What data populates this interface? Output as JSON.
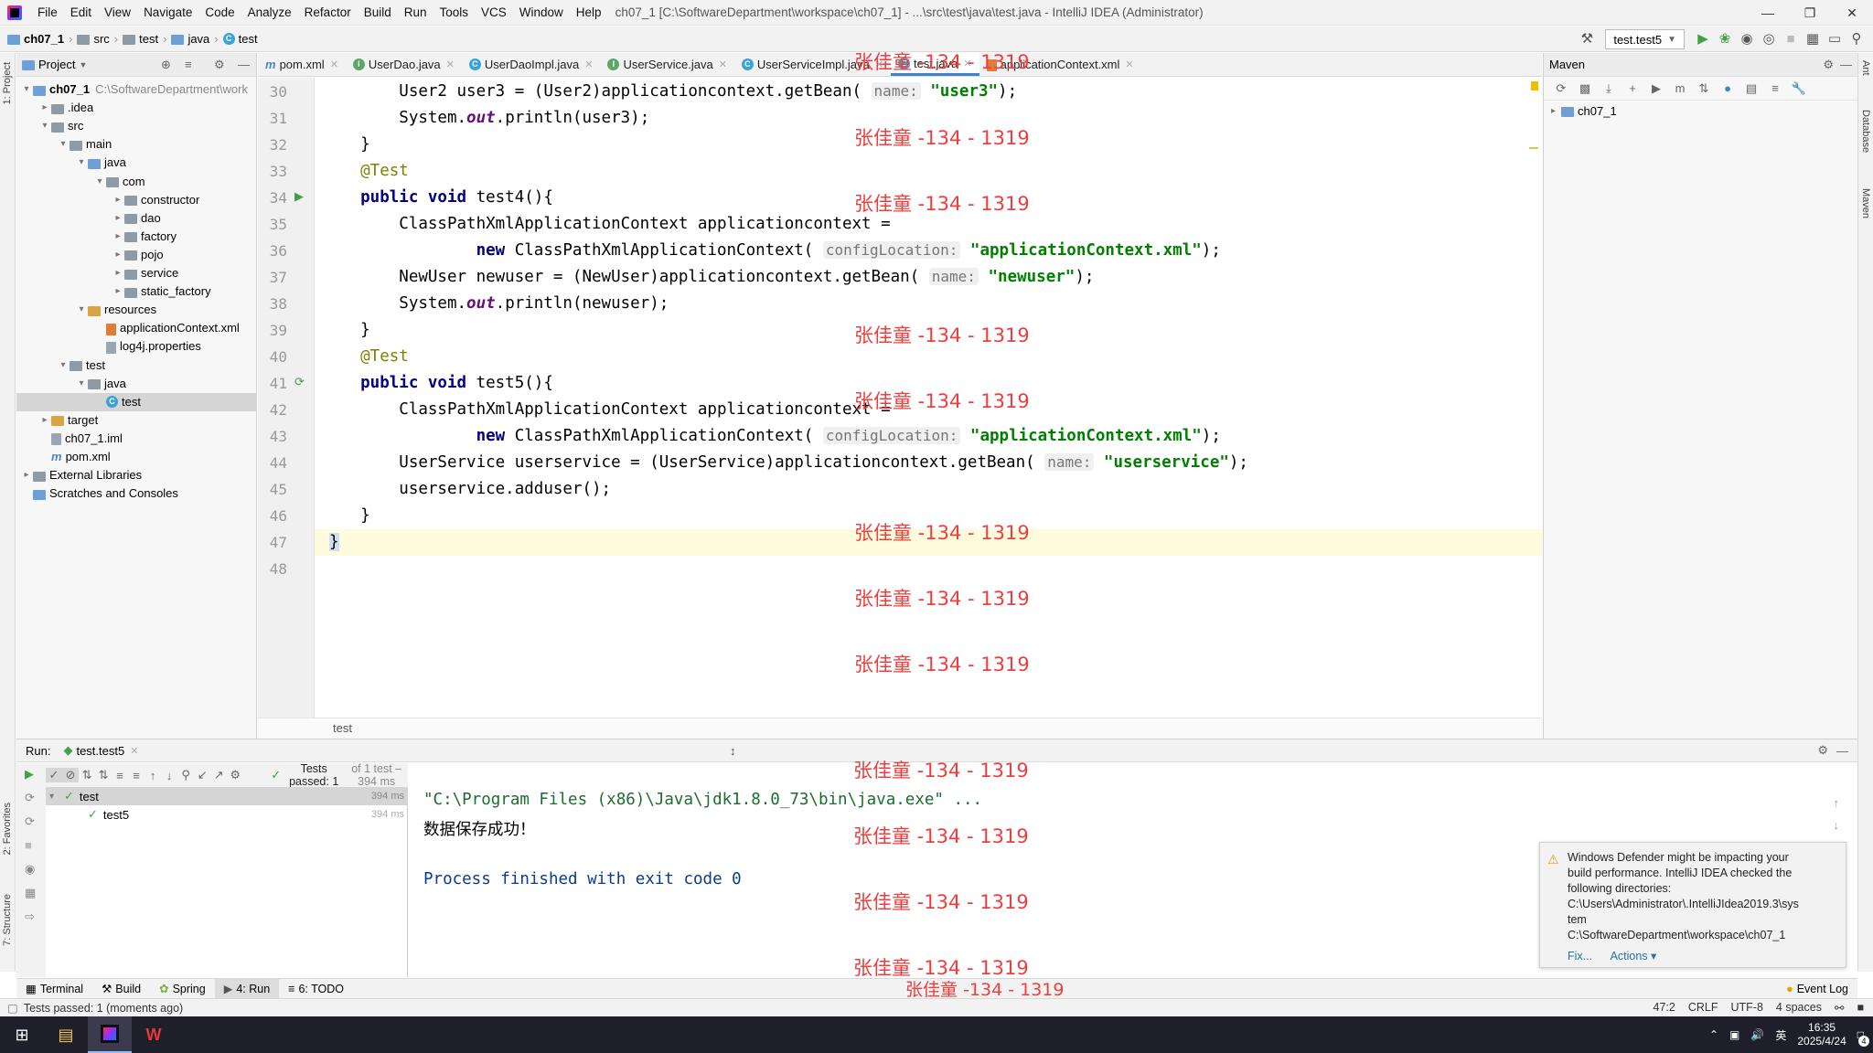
{
  "menu": [
    "File",
    "Edit",
    "View",
    "Navigate",
    "Code",
    "Analyze",
    "Refactor",
    "Build",
    "Run",
    "Tools",
    "VCS",
    "Window",
    "Help"
  ],
  "window_title": "ch07_1 [C:\\SoftwareDepartment\\workspace\\ch07_1] - ...\\src\\test\\java\\test.java - IntelliJ IDEA (Administrator)",
  "breadcrumb": [
    "ch07_1",
    "src",
    "test",
    "java",
    "test"
  ],
  "run_config": "test.test5",
  "project_panel": {
    "title": "Project",
    "tree": [
      {
        "label": "ch07_1",
        "note": "C:\\SoftwareDepartment\\work",
        "depth": 0,
        "arrow": "▾",
        "icon": "module-folder"
      },
      {
        "label": ".idea",
        "depth": 1,
        "arrow": "▸",
        "icon": "folder"
      },
      {
        "label": "src",
        "depth": 1,
        "arrow": "▾",
        "icon": "folder"
      },
      {
        "label": "main",
        "depth": 2,
        "arrow": "▾",
        "icon": "folder"
      },
      {
        "label": "java",
        "depth": 3,
        "arrow": "▾",
        "icon": "source-folder"
      },
      {
        "label": "com",
        "depth": 4,
        "arrow": "▾",
        "icon": "package"
      },
      {
        "label": "constructor",
        "depth": 5,
        "arrow": "▸",
        "icon": "package"
      },
      {
        "label": "dao",
        "depth": 5,
        "arrow": "▸",
        "icon": "package"
      },
      {
        "label": "factory",
        "depth": 5,
        "arrow": "▸",
        "icon": "package"
      },
      {
        "label": "pojo",
        "depth": 5,
        "arrow": "▸",
        "icon": "package"
      },
      {
        "label": "service",
        "depth": 5,
        "arrow": "▸",
        "icon": "package"
      },
      {
        "label": "static_factory",
        "depth": 5,
        "arrow": "▸",
        "icon": "package"
      },
      {
        "label": "resources",
        "depth": 3,
        "arrow": "▾",
        "icon": "resources-folder"
      },
      {
        "label": "applicationContext.xml",
        "depth": 4,
        "arrow": "",
        "icon": "xml-file"
      },
      {
        "label": "log4j.properties",
        "depth": 4,
        "arrow": "",
        "icon": "properties-file"
      },
      {
        "label": "test",
        "depth": 2,
        "arrow": "▾",
        "icon": "folder"
      },
      {
        "label": "java",
        "depth": 3,
        "arrow": "▾",
        "icon": "test-source-folder"
      },
      {
        "label": "test",
        "depth": 4,
        "arrow": "",
        "icon": "class-file",
        "selected": true
      },
      {
        "label": "target",
        "depth": 1,
        "arrow": "▸",
        "icon": "excluded-folder"
      },
      {
        "label": "ch07_1.iml",
        "depth": 1,
        "arrow": "",
        "icon": "iml-file"
      },
      {
        "label": "pom.xml",
        "depth": 1,
        "arrow": "",
        "icon": "maven-file"
      },
      {
        "label": "External Libraries",
        "depth": 0,
        "arrow": "▸",
        "icon": "libraries"
      },
      {
        "label": "Scratches and Consoles",
        "depth": 0,
        "arrow": "",
        "icon": "scratches"
      }
    ]
  },
  "editor_tabs": [
    {
      "label": "pom.xml",
      "icon": "m"
    },
    {
      "label": "UserDao.java",
      "icon": "I"
    },
    {
      "label": "UserDaoImpl.java",
      "icon": "C"
    },
    {
      "label": "UserService.java",
      "icon": "I"
    },
    {
      "label": "UserServiceImpl.java",
      "icon": "C"
    },
    {
      "label": "test.java",
      "icon": "C",
      "active": true
    },
    {
      "label": "applicationContext.xml",
      "icon": "xml"
    }
  ],
  "editor_breadcrumb": "test",
  "code_lines": [
    {
      "n": "30"
    },
    {
      "n": "31"
    },
    {
      "n": "32"
    },
    {
      "n": "33"
    },
    {
      "n": "34"
    },
    {
      "n": "35"
    },
    {
      "n": "36"
    },
    {
      "n": "37"
    },
    {
      "n": "38"
    },
    {
      "n": "39"
    },
    {
      "n": "40"
    },
    {
      "n": "41"
    },
    {
      "n": "42"
    },
    {
      "n": "43"
    },
    {
      "n": "44"
    },
    {
      "n": "45"
    },
    {
      "n": "46"
    },
    {
      "n": "47"
    },
    {
      "n": "48"
    }
  ],
  "code": {
    "l30a": "        User2 user3 = (User2)applicationcontext.getBean( ",
    "l30h": "name:",
    "l30s": "\"user3\"",
    "l30e": ");",
    "l31a": "        System.",
    "l31i": "out",
    "l31e": ".println(user3);",
    "l32": "    }",
    "l33": "    @Test",
    "l34k": "    public void ",
    "l34e": "test4(){",
    "l35": "        ClassPathXmlApplicationContext applicationcontext =",
    "l36k": "                new ",
    "l36a": "ClassPathXmlApplicationContext( ",
    "l36h": "configLocation:",
    "l36s": "\"applicationContext.xml\"",
    "l36e": ");",
    "l37a": "        NewUser newuser = (NewUser)applicationcontext.getBean( ",
    "l37h": "name:",
    "l37s": "\"newuser\"",
    "l37e": ");",
    "l38a": "        System.",
    "l38i": "out",
    "l38e": ".println(newuser);",
    "l39": "    }",
    "l40": "    @Test",
    "l41k": "    public void ",
    "l41e": "test5(){",
    "l42": "        ClassPathXmlApplicationContext applicationcontext =",
    "l43k": "                new ",
    "l43a": "ClassPathXmlApplicationContext( ",
    "l43h": "configLocation:",
    "l43s": "\"applicationContext.xml\"",
    "l43e": ");",
    "l44a": "        UserService userservice = (UserService)applicationcontext.getBean( ",
    "l44h": "name:",
    "l44s": "\"userservice\"",
    "l44e": ");",
    "l45": "        userservice.adduser();",
    "l46": "    }",
    "l47": "}"
  },
  "watermark": "张佳童 -134 - 1319",
  "maven": {
    "title": "Maven",
    "root": "ch07_1"
  },
  "run_panel": {
    "label": "Run:",
    "tab": "test.test5",
    "status": "Tests passed: 1",
    "status_detail": "of 1 test – 394 ms",
    "tree": [
      {
        "label": "test",
        "time": "394 ms"
      },
      {
        "label": "test5",
        "time": "394 ms"
      }
    ],
    "console": [
      "\"C:\\Program Files (x86)\\Java\\jdk1.8.0_73\\bin\\java.exe\" ...",
      "数据保存成功！",
      "",
      "Process finished with exit code 0"
    ]
  },
  "notification": {
    "lines": [
      "Windows Defender might be impacting your",
      "build performance. IntelliJ IDEA checked the",
      "following directories:",
      "C:\\Users\\Administrator\\.IntelliJIdea2019.3\\sys",
      "tem",
      "C:\\SoftwareDepartment\\workspace\\ch07_1"
    ],
    "fix": "Fix...",
    "actions": "Actions ▾"
  },
  "tool_tabs": [
    {
      "label": "Terminal"
    },
    {
      "label": "Build"
    },
    {
      "label": "Spring"
    },
    {
      "label": "4: Run",
      "active": true
    },
    {
      "label": "6: TODO"
    }
  ],
  "event_log": "Event Log",
  "left_stripe": [
    "1: Project",
    "2: Favorites",
    "7: Structure"
  ],
  "right_stripe": [
    "Ant",
    "Database",
    "Maven"
  ],
  "status_bar": {
    "message": "Tests passed: 1 (moments ago)",
    "position": "47:2",
    "line_sep": "CRLF",
    "encoding": "UTF-8",
    "indent": "4 spaces"
  },
  "taskbar": {
    "ime": "英",
    "time": "16:35",
    "date": "2025/4/24",
    "badge": "4"
  },
  "colors": {
    "accent": "#4083c9",
    "string": "#008000",
    "keyword": "#000080",
    "annotation": "#808000",
    "watermark": "#ef3e3e"
  }
}
